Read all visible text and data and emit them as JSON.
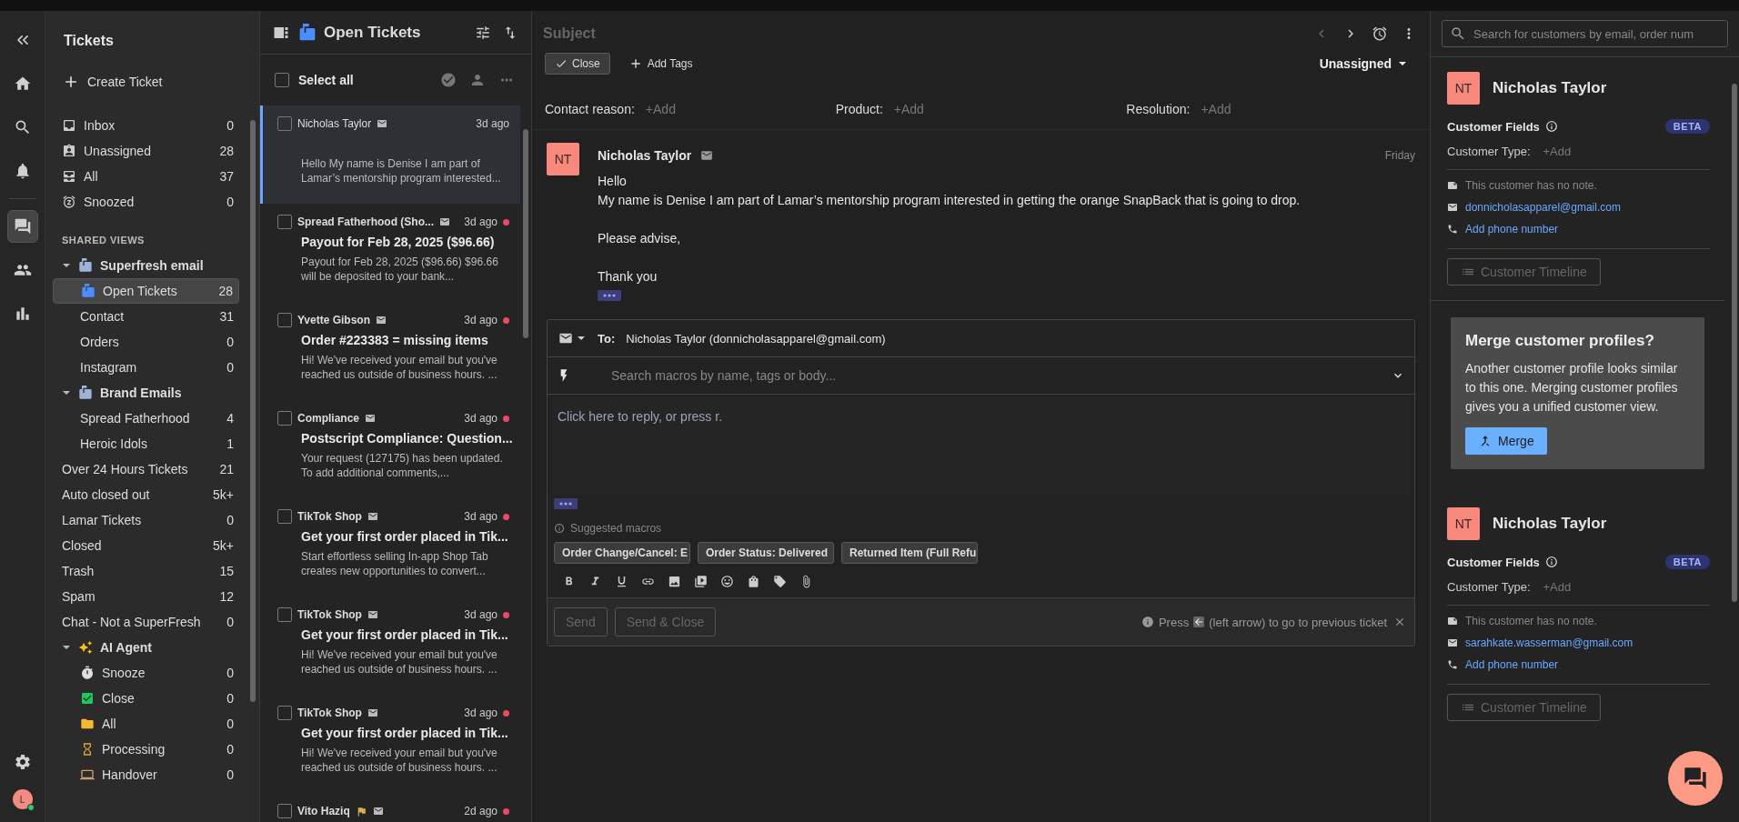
{
  "rail": {
    "items": [
      {
        "selected": false
      },
      {
        "selected": false
      },
      {
        "selected": false
      },
      {
        "selected": false
      },
      {
        "selected": true
      },
      {
        "selected": false
      },
      {
        "selected": false
      }
    ],
    "settings": {
      "selected": false
    },
    "avatar": {
      "initial": "L",
      "online": true
    }
  },
  "nav": {
    "title": "Tickets",
    "create": "Create Ticket",
    "items": [
      {
        "label": "Inbox",
        "count": "0",
        "selected": false
      },
      {
        "label": "Unassigned",
        "count": "28",
        "selected": false
      },
      {
        "label": "All",
        "count": "37",
        "selected": false
      },
      {
        "label": "Snoozed",
        "count": "0",
        "selected": false
      }
    ],
    "shared_heading": "SHARED VIEWS",
    "views": [
      {
        "label": "Superfresh email",
        "expanded": true,
        "children": [
          {
            "label": "Open Tickets",
            "count": "28",
            "selected": true
          },
          {
            "label": "Contact",
            "count": "31",
            "selected": false
          },
          {
            "label": "Orders",
            "count": "0",
            "selected": false
          },
          {
            "label": "Instagram",
            "count": "0",
            "selected": false
          }
        ]
      },
      {
        "label": "Brand Emails",
        "expanded": true,
        "children": [
          {
            "label": "Spread Fatherhood",
            "count": "4",
            "selected": false
          },
          {
            "label": "Heroic Idols",
            "count": "1",
            "selected": false
          }
        ]
      },
      {
        "label": "Over 24 Hours Tickets",
        "count": "21",
        "selected": false
      },
      {
        "label": "Auto closed out",
        "count": "5k+",
        "selected": false
      },
      {
        "label": "Lamar Tickets",
        "count": "0",
        "selected": false
      },
      {
        "label": "Closed",
        "count": "5k+",
        "selected": false
      },
      {
        "label": "Trash",
        "count": "15",
        "selected": false
      },
      {
        "label": "Spam",
        "count": "12",
        "selected": false
      },
      {
        "label": "Chat - Not a SuperFresh",
        "count": "0",
        "selected": false
      },
      {
        "label": "AI Agent",
        "expanded": true,
        "children": [
          {
            "label": "Snooze",
            "count": "0",
            "selected": false
          },
          {
            "label": "Close",
            "count": "0",
            "selected": false
          },
          {
            "label": "All",
            "count": "0",
            "selected": false
          },
          {
            "label": "Processing",
            "count": "0",
            "selected": false
          },
          {
            "label": "Handover",
            "count": "0",
            "selected": false
          }
        ]
      }
    ]
  },
  "ticket_list": {
    "title": "Open Tickets",
    "select_all": "Select all",
    "select_all_checked": false,
    "tickets": [
      {
        "sender": "Nicholas Taylor",
        "time": "3d ago",
        "preview": "Hello My name is Denise I am part of Lamar’s mentorship program interested...",
        "unread": false,
        "selected": true,
        "checked": false,
        "flag": false
      },
      {
        "sender": "Spread Fatherhood (Sho...",
        "time": "3d ago",
        "subject": "Payout for Feb 28, 2025 ($96.66)",
        "preview": "Payout for Feb 28, 2025 ($96.66) $96.66 will be deposited to your bank...",
        "unread": true,
        "selected": false,
        "checked": false,
        "flag": false
      },
      {
        "sender": "Yvette Gibson",
        "time": "3d ago",
        "subject": "Order #223383 = missing items",
        "preview": "Hi! We've received your email but you've reached us outside of business hours. ...",
        "unread": true,
        "selected": false,
        "checked": false,
        "flag": false
      },
      {
        "sender": "Compliance",
        "time": "3d ago",
        "subject": "Postscript Compliance: Question...",
        "preview": "Your request (127175) has been updated. To add additional comments,...",
        "unread": true,
        "selected": false,
        "checked": false,
        "flag": false
      },
      {
        "sender": "TikTok Shop",
        "time": "3d ago",
        "subject": "Get your first order placed in Tik...",
        "preview": "Start effortless selling In-app Shop Tab creates new opportunities to convert...",
        "unread": true,
        "selected": false,
        "checked": false,
        "flag": false
      },
      {
        "sender": "TikTok Shop",
        "time": "3d ago",
        "subject": "Get your first order placed in Tik...",
        "preview": "Hi! We've received your email but you've reached us outside of business hours. ...",
        "unread": true,
        "selected": false,
        "checked": false,
        "flag": false
      },
      {
        "sender": "TikTok Shop",
        "time": "3d ago",
        "subject": "Get your first order placed in Tik...",
        "preview": "Hi! We've received your email but you've reached us outside of business hours. ...",
        "unread": true,
        "selected": false,
        "checked": false,
        "flag": false
      },
      {
        "sender": "Vito Haziq",
        "time": "2d ago",
        "unread": true,
        "selected": false,
        "checked": false,
        "flag": true
      }
    ]
  },
  "ticket": {
    "subject_placeholder": "Subject",
    "close": "Close",
    "add_tags": "Add Tags",
    "assignee": "Unassigned",
    "fields": [
      {
        "label": "Contact reason:",
        "value": "+Add"
      },
      {
        "label": "Product:",
        "value": "+Add"
      },
      {
        "label": "Resolution:",
        "value": "+Add"
      }
    ],
    "message": {
      "initials": "NT",
      "sender": "Nicholas Taylor",
      "time": "Friday",
      "paragraphs": [
        [
          "Hello",
          "My name is Denise I am part of Lamar’s mentorship program interested in getting the orange SnapBack that is going to drop."
        ],
        [
          "Please advise,"
        ],
        [
          "Thank you"
        ]
      ]
    },
    "reply": {
      "to_label": "To:",
      "to": "Nicholas Taylor (donnicholasapparel@gmail.com)",
      "macro_placeholder": "Search macros by name, tags or body...",
      "body_placeholder": "Click here to reply, or press r.",
      "suggested_label": "Suggested macros",
      "macros": [
        "Order Change/Cancel: E",
        "Order Status: Delivered",
        "Returned Item (Full Refu"
      ],
      "send": "Send",
      "send_close": "Send & Close",
      "send_disabled": true,
      "hint_before": "Press",
      "hint_after": "(left arrow) to go to previous ticket"
    }
  },
  "customer_panel": {
    "search_placeholder": "Search for customers by email, order num",
    "profiles": [
      {
        "initials": "NT",
        "name": "Nicholas Taylor",
        "fields_title": "Customer Fields",
        "badge": "BETA",
        "type_label": "Customer Type:",
        "type_value": "+Add",
        "note": "This customer has no note.",
        "email": "donnicholasapparel@gmail.com",
        "phone": "Add phone number",
        "timeline": "Customer Timeline"
      },
      {
        "initials": "NT",
        "name": "Nicholas Taylor",
        "fields_title": "Customer Fields",
        "badge": "BETA",
        "type_label": "Customer Type:",
        "type_value": "+Add",
        "note": "This customer has no note.",
        "email": "sarahkate.wasserman@gmail.com",
        "phone": "Add phone number",
        "timeline": "Customer Timeline"
      }
    ],
    "merge": {
      "title": "Merge customer profiles?",
      "text": "Another customer profile looks similar to this one. Merging customer profiles gives you a unified customer view.",
      "button": "Merge"
    }
  }
}
